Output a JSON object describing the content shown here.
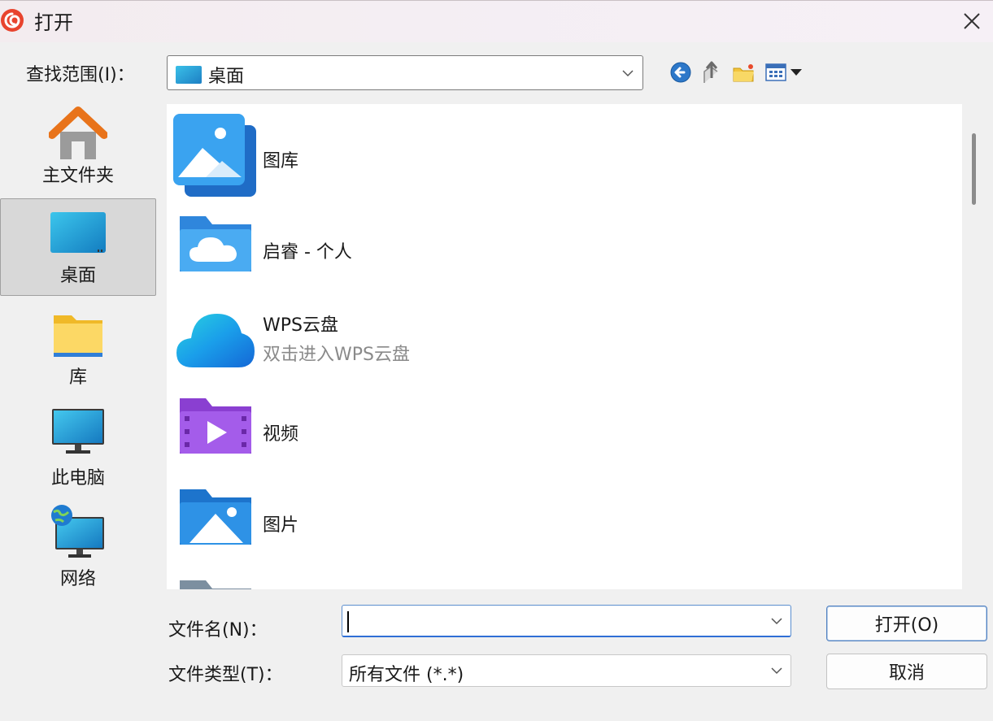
{
  "window": {
    "title": "打开",
    "close_icon": "close-icon"
  },
  "look_in": {
    "label": "查找范围(I)：",
    "value": "桌面"
  },
  "toolbar": {
    "icons": [
      "back-icon",
      "up-folder-icon",
      "new-folder-icon",
      "view-menu-icon"
    ]
  },
  "sidebar": {
    "items": [
      {
        "label": "主文件夹",
        "icon": "home-icon"
      },
      {
        "label": "桌面",
        "icon": "desktop-icon",
        "selected": true
      },
      {
        "label": "库",
        "icon": "folder-icon"
      },
      {
        "label": "此电脑",
        "icon": "computer-icon"
      },
      {
        "label": "网络",
        "icon": "network-icon"
      }
    ]
  },
  "files": [
    {
      "name": "图库",
      "icon": "gallery-icon"
    },
    {
      "name": "启睿 - 个人",
      "icon": "cloud-folder-icon"
    },
    {
      "name": "WPS云盘",
      "subtitle": "双击进入WPS云盘",
      "icon": "wps-cloud-icon"
    },
    {
      "name": "视频",
      "icon": "video-folder-icon"
    },
    {
      "name": "图片",
      "icon": "pictures-folder-icon"
    }
  ],
  "filename": {
    "label": "文件名(N)：",
    "value": ""
  },
  "filetype": {
    "label": "文件类型(T)：",
    "value": "所有文件 (*.*)"
  },
  "buttons": {
    "open": "打开(O)",
    "cancel": "取消"
  },
  "colors": {
    "accent": "#2f6fd6",
    "selection": "#d8d8d8"
  }
}
